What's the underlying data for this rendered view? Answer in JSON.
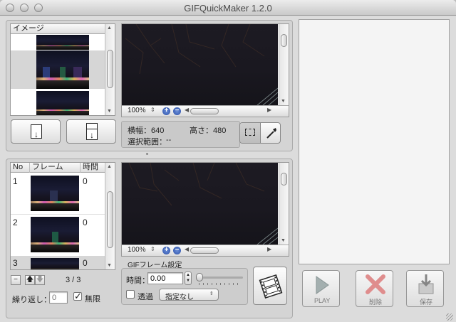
{
  "window": {
    "title": "GIFQuickMaker 1.2.0"
  },
  "image_list": {
    "header": "イメージ"
  },
  "import_buttons": {
    "add_label": "↓",
    "insert_label": "↓"
  },
  "top_preview": {
    "zoom": "100%"
  },
  "info": {
    "width_label": "横幅：640",
    "height_label": "高さ：480",
    "selection_label": "選択範囲：",
    "selection_value": "--"
  },
  "frame_list": {
    "headers": {
      "no": "No",
      "frame": "フレーム",
      "time": "時間"
    },
    "rows": [
      {
        "no": "1",
        "time": "0"
      },
      {
        "no": "2",
        "time": "0"
      },
      {
        "no": "3",
        "time": "0"
      }
    ]
  },
  "frame_controls": {
    "counter": "3 / 3",
    "repeat_label": "繰り返し：",
    "repeat_placeholder": "0",
    "infinite_label": "無限"
  },
  "bottom_preview": {
    "zoom": "100%"
  },
  "gif_settings": {
    "group_title": "GIFフレーム設定",
    "time_label": "時間：",
    "time_value": "0.00",
    "transparency_label": "透過",
    "transparency_option": "指定なし"
  },
  "actions": {
    "play": "PLAY",
    "delete": "削除",
    "save": "保存"
  }
}
